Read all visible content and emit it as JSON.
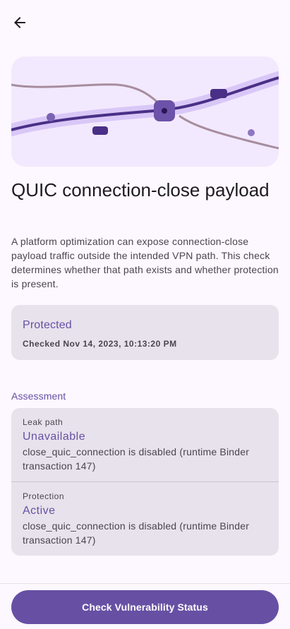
{
  "header": {
    "back_icon": "arrow-back-icon"
  },
  "hero": {
    "illustration": "network-paths-illustration"
  },
  "page": {
    "title": "QUIC connection-close payload",
    "description": "A platform optimization can expose connection-close payload traffic outside the intended VPN path. This check determines whether that path exists and whether protection is present."
  },
  "status": {
    "label": "Protected",
    "checked": "Checked Nov 14, 2023, 10:13:20 PM"
  },
  "assessment": {
    "title": "Assessment",
    "rows": [
      {
        "label": "Leak path",
        "value": "Unavailable",
        "detail": "close_quic_connection is disabled (runtime Binder transaction 147)"
      },
      {
        "label": "Protection",
        "value": "Active",
        "detail": "close_quic_connection is disabled (runtime Binder transaction 147)"
      }
    ]
  },
  "action": {
    "label": "Check Vulnerability Status"
  },
  "colors": {
    "primary": "#6750a4",
    "background": "#fdf7ff",
    "card": "#e8e2ec",
    "hero": "#f2e9fe",
    "hero_line": "#4a2f86",
    "hero_band": "#d9c7f7",
    "hero_mauve": "#a78d9e"
  }
}
